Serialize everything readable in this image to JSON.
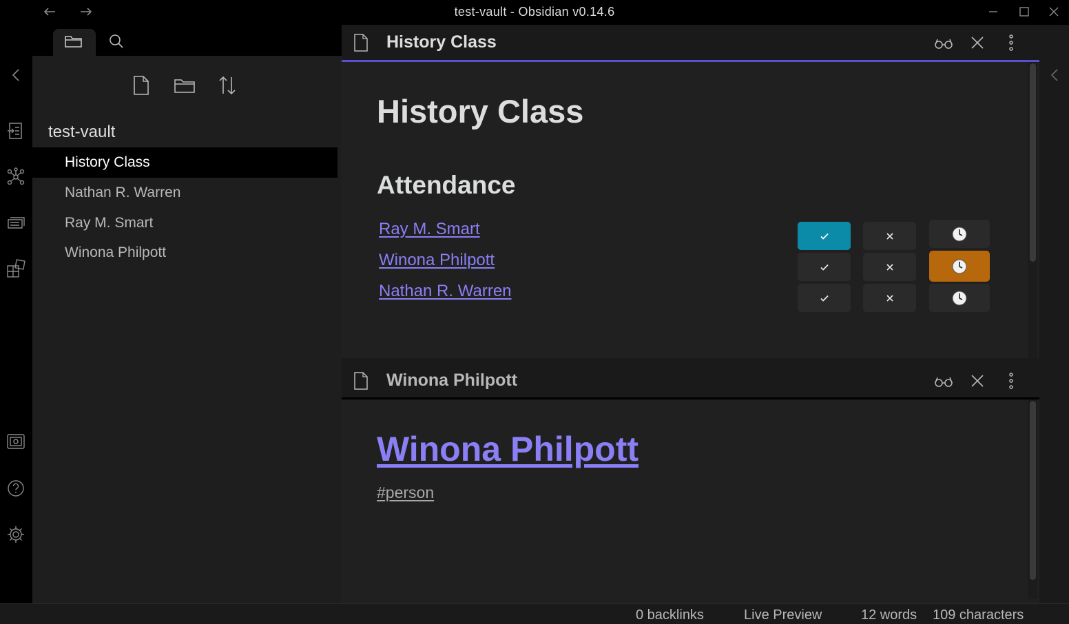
{
  "window": {
    "title": "test-vault - Obsidian v0.14.6"
  },
  "sidebar": {
    "vault_name": "test-vault",
    "files": [
      {
        "label": "History Class",
        "active": true
      },
      {
        "label": "Nathan R. Warren",
        "active": false
      },
      {
        "label": "Ray M. Smart",
        "active": false
      },
      {
        "label": "Winona Philpott",
        "active": false
      }
    ]
  },
  "pane1": {
    "tab_title": "History Class",
    "heading": "History Class",
    "subheading": "Attendance",
    "attendance": [
      {
        "name": "Ray M. Smart",
        "status": "present"
      },
      {
        "name": "Winona Philpott",
        "status": "late"
      },
      {
        "name": "Nathan R. Warren",
        "status": "none"
      }
    ]
  },
  "pane2": {
    "tab_title": "Winona Philpott",
    "heading": "Winona Philpott",
    "tag": "#person"
  },
  "statusbar": {
    "backlinks": "0 backlinks",
    "mode": "Live Preview",
    "words": "12 words",
    "characters": "109 characters"
  },
  "colors": {
    "accent": "#5a4fcf",
    "link": "#8a7ff5",
    "present": "#0c8ba8",
    "late": "#b8680c"
  }
}
